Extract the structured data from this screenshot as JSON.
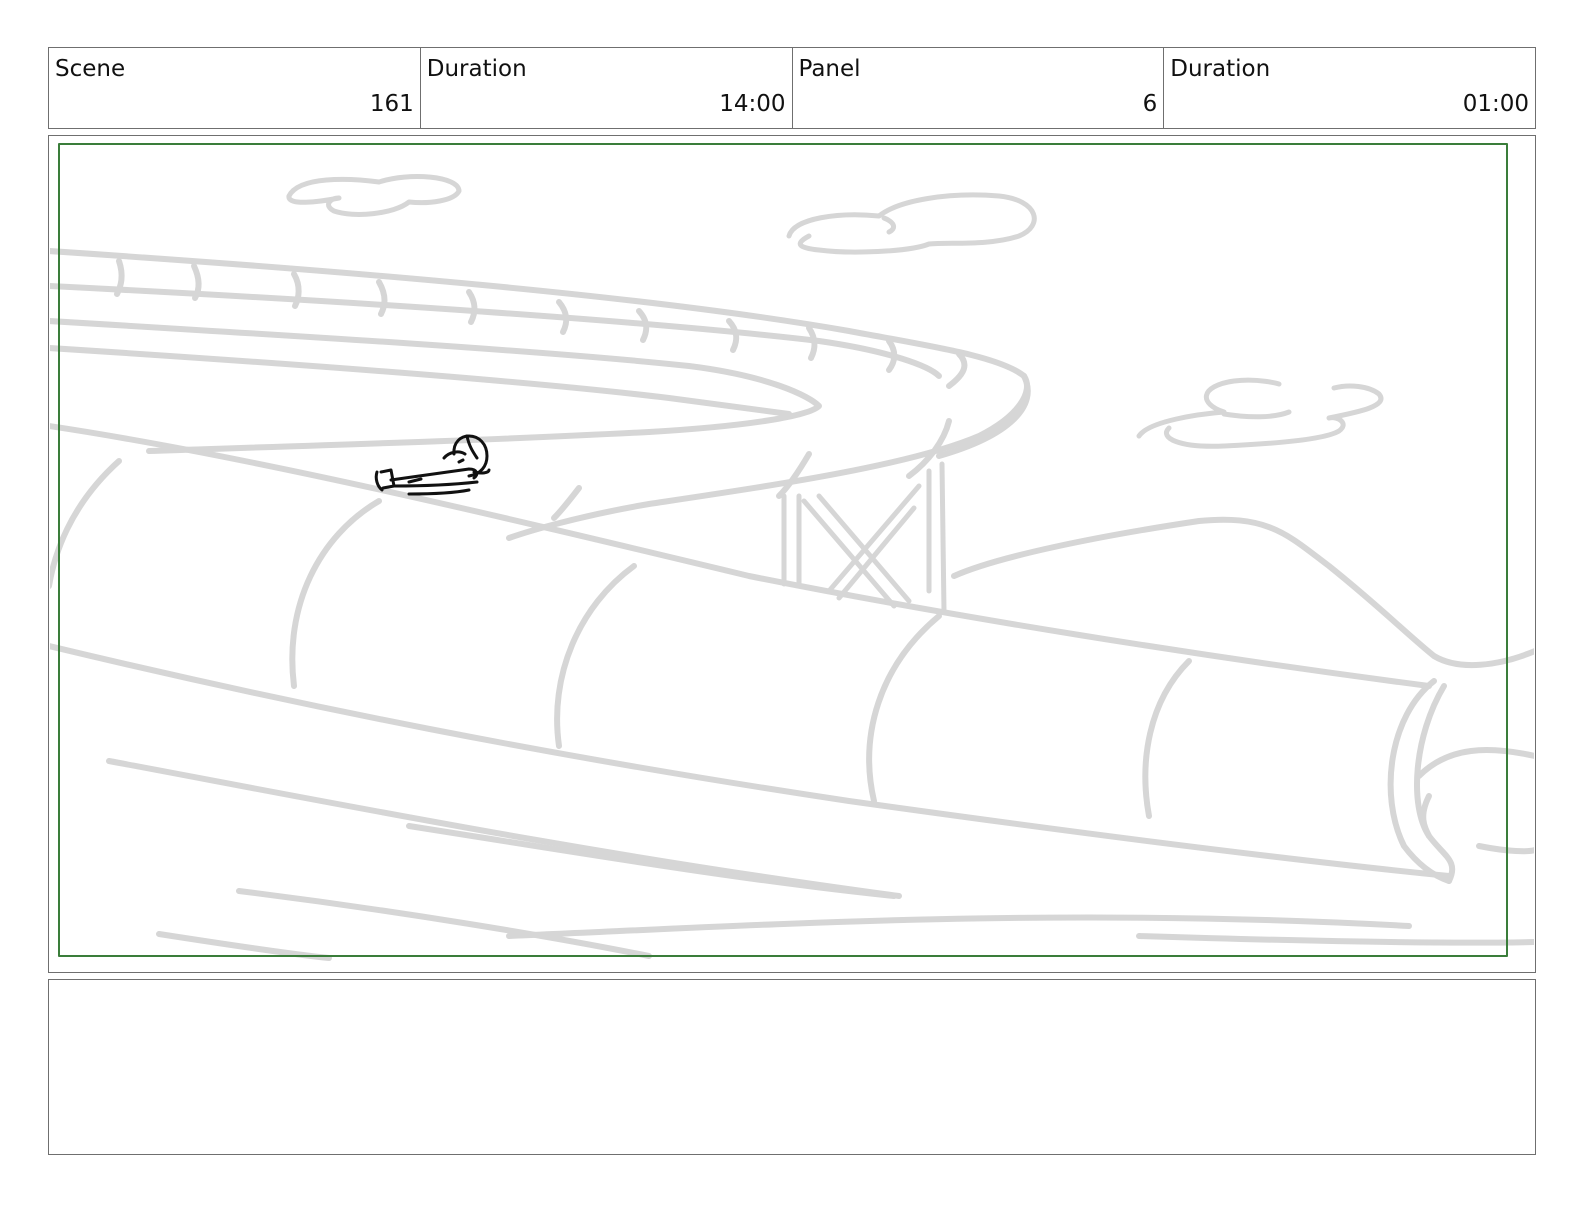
{
  "header": {
    "cells": [
      {
        "label": "Scene",
        "value": "161"
      },
      {
        "label": "Duration",
        "value": "14:00"
      },
      {
        "label": "Panel",
        "value": "6"
      },
      {
        "label": "Duration",
        "value": "01:00"
      }
    ]
  },
  "panel": {
    "safe_area_color": "#3a7d3a",
    "sketch_color": "#d6d6d6",
    "figure_color": "#111111"
  },
  "notes": {
    "text": ""
  }
}
